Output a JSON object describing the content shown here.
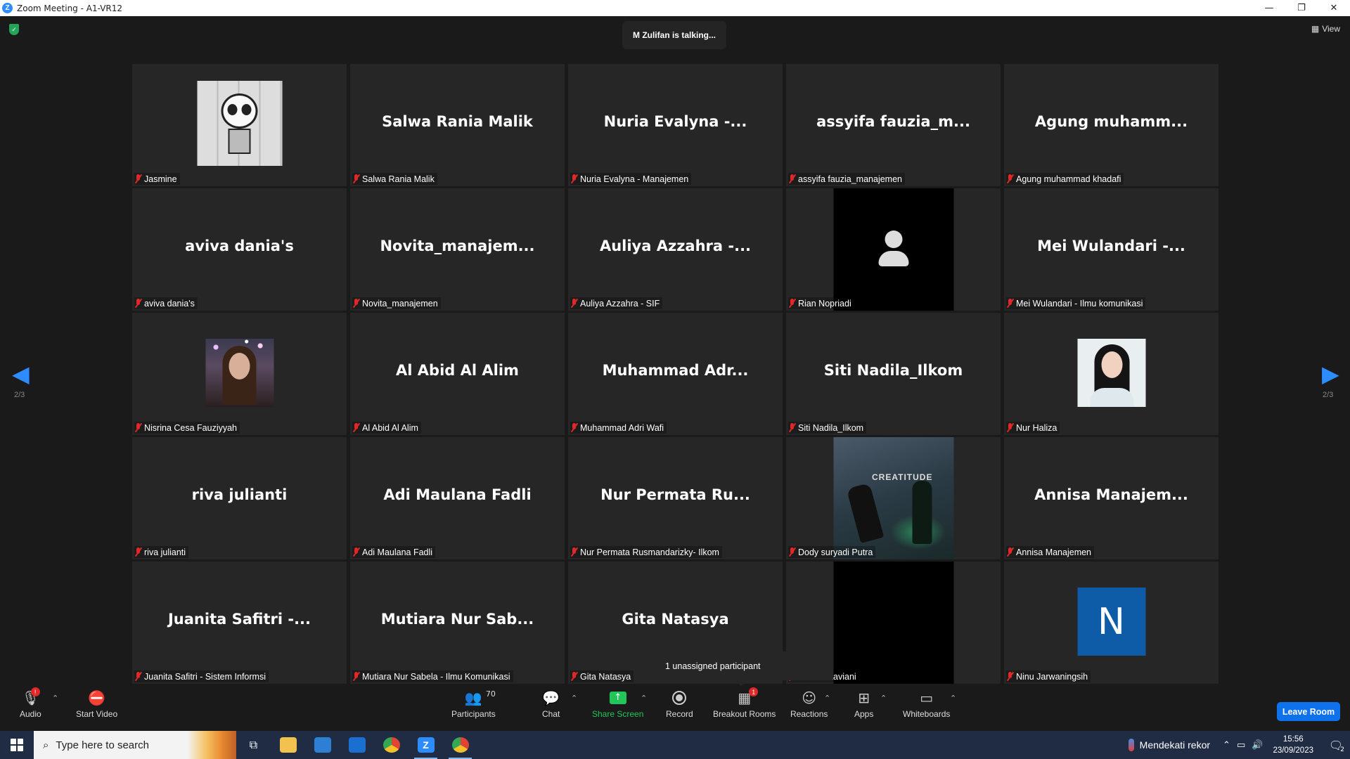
{
  "window": {
    "title": "Zoom Meeting - A1-VR12",
    "minimize": "—",
    "restore": "❐",
    "close": "✕"
  },
  "meeting": {
    "talking": "M Zulifan is talking...",
    "view_label": "View",
    "page_indicator": "2/3",
    "unassigned": "1 unassigned participant"
  },
  "tiles": [
    {
      "name": "Jasmine",
      "display": "",
      "media": "cartoon-image"
    },
    {
      "name": "Salwa Rania Malik",
      "display": "Salwa Rania Malik"
    },
    {
      "name": "Nuria Evalyna - Manajemen",
      "display": "Nuria Evalyna -..."
    },
    {
      "name": "assyifa fauzia_manajemen",
      "display": "assyifa fauzia_m..."
    },
    {
      "name": "Agung muhammad khadafi",
      "display": "Agung muhamm..."
    },
    {
      "name": "aviva dania's",
      "display": "aviva dania's"
    },
    {
      "name": "Novita_manajemen",
      "display": "Novita_manajem..."
    },
    {
      "name": "Auliya Azzahra - SIF",
      "display": "Auliya Azzahra -..."
    },
    {
      "name": "Rian Nopriadi",
      "display": "",
      "media": "default-avatar"
    },
    {
      "name": "Mei Wulandari - Ilmu komunikasi",
      "display": "Mei Wulandari -..."
    },
    {
      "name": "Nisrina Cesa Fauziyyah",
      "display": "",
      "media": "profile-photo"
    },
    {
      "name": "Al Abid Al Alim",
      "display": "Al Abid Al Alim"
    },
    {
      "name": "Muhammad Adri Wafi",
      "display": "Muhammad Adr..."
    },
    {
      "name": "Siti Nadila_Ilkom",
      "display": "Siti Nadila_Ilkom"
    },
    {
      "name": "Nur Haliza",
      "display": "",
      "media": "profile-photo"
    },
    {
      "name": "riva julianti",
      "display": "riva julianti"
    },
    {
      "name": "Adi Maulana Fadli",
      "display": "Adi Maulana Fadli"
    },
    {
      "name": "Nur Permata Rusmandarizky- Ilkom",
      "display": "Nur Permata Ru..."
    },
    {
      "name": "Dody suryadi Putra",
      "display": "",
      "media": "concert-photo",
      "overlay_text": "CREATITUDE"
    },
    {
      "name": "Annisa Manajemen",
      "display": "Annisa Manajem..."
    },
    {
      "name": "Juanita Safitri - Sistem Informsi",
      "display": "Juanita Safitri -..."
    },
    {
      "name": "Mutiara Nur Sabela - Ilmu Komunikasi",
      "display": "Mutiara Nur Sab..."
    },
    {
      "name": "Gita Natasya",
      "display": "Gita Natasya"
    },
    {
      "name": "Noer Octaviani",
      "display": "",
      "media": "black-video"
    },
    {
      "name": "Ninu Jarwaningsih",
      "display": "",
      "media": "initial-avatar",
      "initial": "N"
    }
  ],
  "toolbar": {
    "audio": "Audio",
    "audio_badge": "!",
    "video": "Start Video",
    "participants": "Participants",
    "participants_count": "70",
    "chat": "Chat",
    "share": "Share Screen",
    "record": "Record",
    "breakout": "Breakout Rooms",
    "breakout_badge": "1",
    "reactions": "Reactions",
    "apps": "Apps",
    "whiteboards": "Whiteboards",
    "leave": "Leave Room"
  },
  "taskbar": {
    "search_placeholder": "Type here to search",
    "weather": "Mendekati rekor",
    "time": "15:56",
    "date": "23/09/2023",
    "notifications": "2"
  },
  "colors": {
    "accent": "#2d8cff",
    "share_green": "#23c45a",
    "leave_blue": "#0e72ed",
    "muted_red": "#e02828",
    "tile_bg": "#262626"
  }
}
